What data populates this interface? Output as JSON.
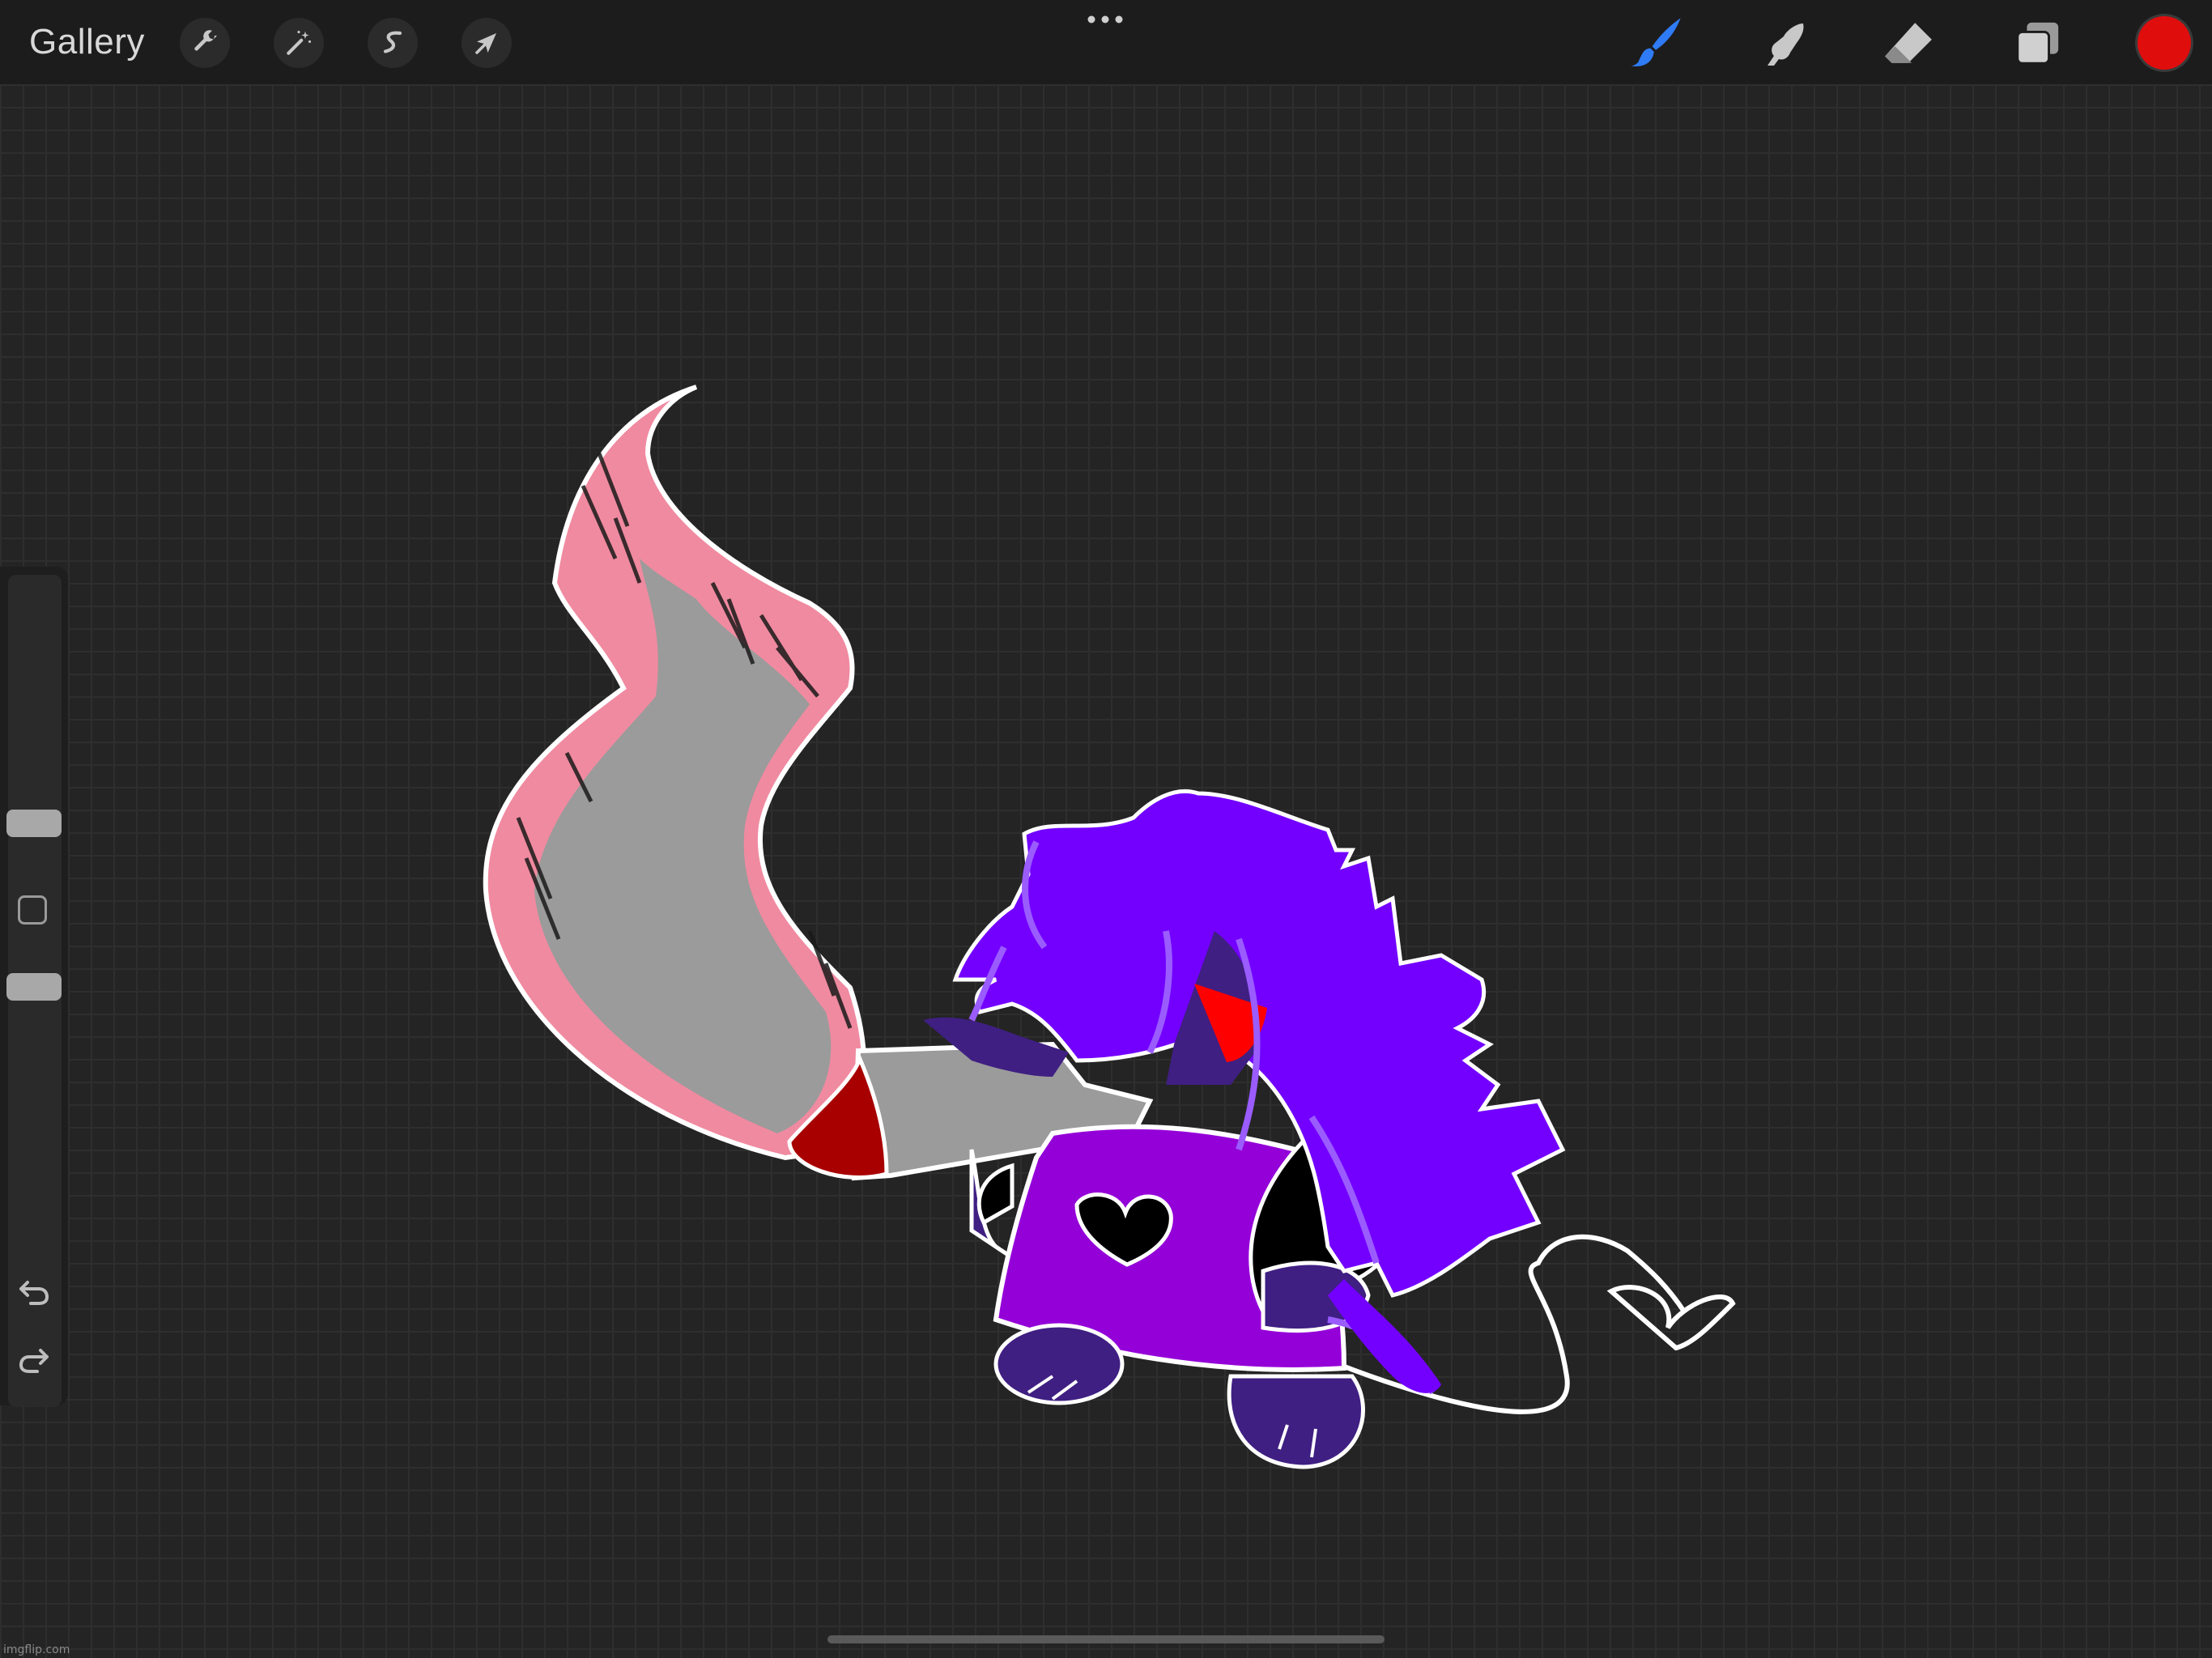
{
  "app": {
    "gallery_label": "Gallery"
  },
  "toolbar": {
    "left_tools": [
      {
        "name": "actions",
        "icon": "wrench-icon"
      },
      {
        "name": "adjustments",
        "icon": "magic-wand-icon"
      },
      {
        "name": "selection",
        "icon": "selection-s-icon"
      },
      {
        "name": "transform",
        "icon": "arrow-cursor-icon"
      }
    ],
    "right_tools": [
      {
        "name": "brush",
        "icon": "brush-icon",
        "active": true,
        "color": "#2f7bf5"
      },
      {
        "name": "smudge",
        "icon": "smudge-finger-icon"
      },
      {
        "name": "eraser",
        "icon": "eraser-icon"
      },
      {
        "name": "layers",
        "icon": "layers-icon"
      }
    ],
    "current_color": "#e00d0d",
    "more_menu_icon": "ellipsis-icon"
  },
  "sidebar": {
    "brush_size": 0.36,
    "brush_opacity": 0.69,
    "undo_icon": "undo-icon",
    "redo_icon": "redo-icon",
    "modifier_icon": "square-modifier-icon"
  },
  "canvas": {
    "background": "#242424",
    "grid": true,
    "palette": {
      "hair_purple": "#7300ff",
      "dress_purple": "#9400d8",
      "fur_dark": "#3f1f82",
      "scarf_pink": "#f08aa0",
      "blade_grey": "#9a9a9a",
      "blood_red": "#a80000",
      "eye_red": "#ff0000"
    }
  },
  "watermark": "imgflip.com"
}
